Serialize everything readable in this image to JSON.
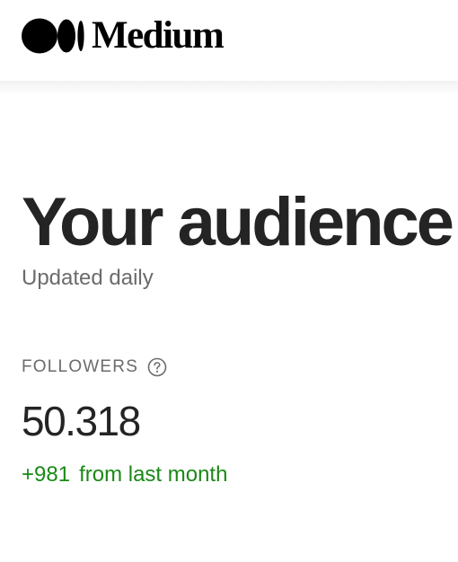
{
  "header": {
    "brand": "Medium",
    "logo_icon": "medium-logo-icon"
  },
  "page": {
    "title": "Your audience",
    "subtitle": "Updated daily"
  },
  "stats": {
    "followers_label": "FOLLOWERS",
    "help_icon": "question-circle-icon",
    "followers_count": "50.318",
    "change_value": "+981",
    "change_suffix": "from last month"
  },
  "colors": {
    "text": "#242424",
    "muted": "#6b6b6b",
    "positive": "#1a8917"
  }
}
